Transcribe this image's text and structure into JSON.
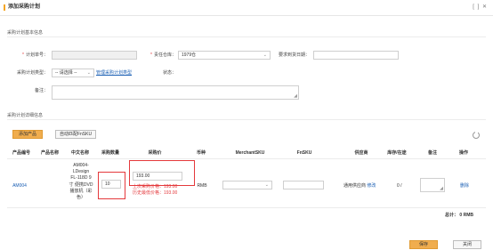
{
  "window": {
    "title": "添加采购计划",
    "controls": "[ ] ✕"
  },
  "basic": {
    "section_title": "采购计划基本信息",
    "plan_no_label": "计划单号：",
    "plan_no_value": "",
    "warehouse_label": "责任仓库：",
    "warehouse_value": "1979仓",
    "arrival_label": "要求到货日期：",
    "arrival_value": "",
    "type_label": "采购计划类型：",
    "type_value": "-- 请选择 --",
    "manage_type_link": "管理采购计划类型",
    "status_label": "状态：",
    "status_value": "",
    "remark_label": "备注："
  },
  "detail": {
    "section_title": "采购计划详细信息",
    "add_product_button": "添加产品",
    "auto_match_button": "自动匹配FnSKU",
    "columns": [
      "产品编号",
      "产品名称",
      "中文名称",
      "采购数量",
      "采购价",
      "币种",
      "MerchantSKU",
      "FnSKU",
      "供应商",
      "库存/在途",
      "备注",
      "操作"
    ],
    "row": {
      "product_no": "AM004",
      "product_name": "",
      "cn_name_lines": [
        "AM004-",
        "LDesign",
        "FL-118D 9",
        "寸 便携DVD",
        "播放机（彩",
        "色）"
      ],
      "quantity": "10",
      "price": "193.00",
      "last_price": "上次采购价格：193.00",
      "min_price": "历史最低价格：193.00",
      "currency": "RMB",
      "merchant_sku": "",
      "fnsku": "",
      "supplier": "通用供应商",
      "supplier_edit": "修改",
      "stock": "0 /",
      "remark": "",
      "delete": "删除"
    },
    "total_label": "总计：",
    "total_value": "0",
    "total_currency": "RMB"
  },
  "footer": {
    "save_button": "保存",
    "close_button": "关闭"
  },
  "colors": {
    "accent": "#f5a623",
    "save": "#f0ad4e",
    "link": "#1a5fb4",
    "error": "#e4393c"
  }
}
